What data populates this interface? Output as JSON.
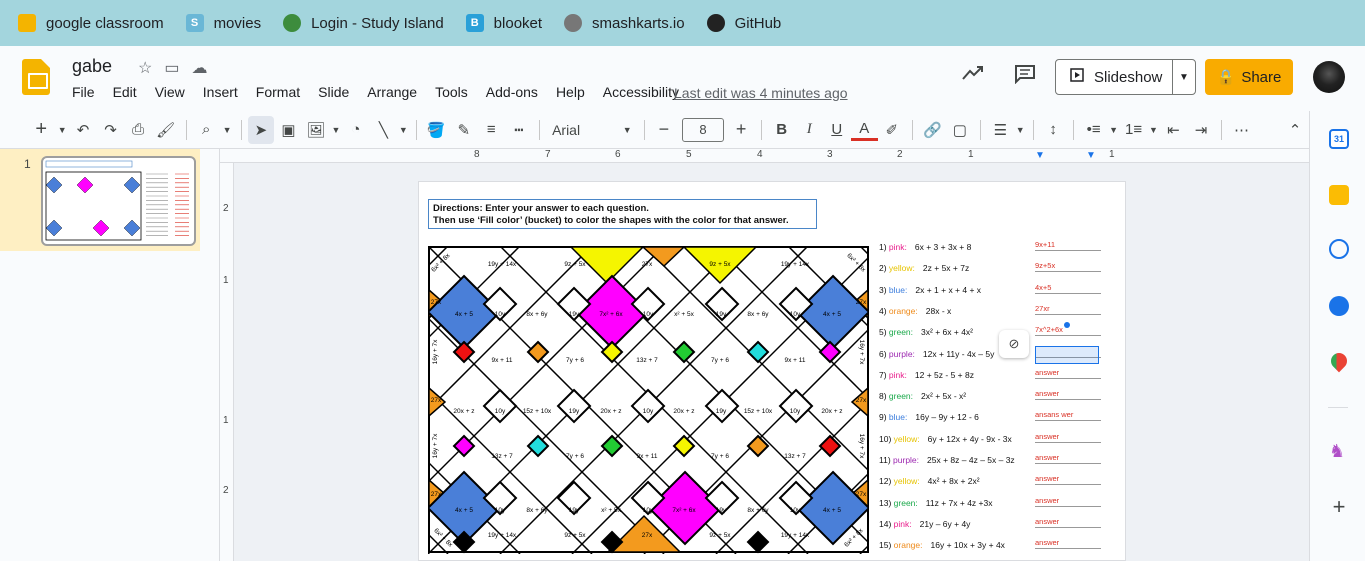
{
  "bookmarks": [
    {
      "label": "google classroom",
      "icon": "classroom-icon",
      "color": "#f4b400",
      "glyph": ""
    },
    {
      "label": "movies",
      "icon": "movies-s-icon",
      "color": "#6ab7d6",
      "glyph": "S"
    },
    {
      "label": "Login - Study Island",
      "icon": "study-island-icon",
      "color": "#3d8c3d",
      "glyph": ""
    },
    {
      "label": "blooket",
      "icon": "blooket-icon",
      "color": "#2aa0d8",
      "glyph": "B"
    },
    {
      "label": "smashkarts.io",
      "icon": "smashkarts-icon",
      "color": "#777777",
      "glyph": ""
    },
    {
      "label": "GitHub",
      "icon": "github-icon",
      "color": "#222222",
      "glyph": ""
    }
  ],
  "doc": {
    "title": "gabe",
    "last_edit": "Last edit was 4 minutes ago"
  },
  "menu": [
    "File",
    "Edit",
    "View",
    "Insert",
    "Format",
    "Slide",
    "Arrange",
    "Tools",
    "Add-ons",
    "Help",
    "Accessibility"
  ],
  "header_buttons": {
    "slideshow": "Slideshow",
    "share": "Share"
  },
  "toolbar": {
    "font": "Arial",
    "font_size": "8"
  },
  "filmstrip": {
    "slide_number": "1"
  },
  "ruler": {
    "top_marks": [
      "8",
      "7",
      "6",
      "5",
      "4",
      "3",
      "2",
      "1",
      "1"
    ],
    "left_marks": [
      "2",
      "1",
      "1",
      "2"
    ]
  },
  "slide": {
    "directions_line1": "Directions: Enter your answer to each question.",
    "directions_line2": "Then use ‘Fill color’ (bucket) to color the shapes with  the color for that answer.",
    "questions": [
      {
        "num": "1)",
        "color_word": "pink:",
        "color": "#e91e8c",
        "expr": "6x + 3 + 3x + 8",
        "answer": "9x+11"
      },
      {
        "num": "2)",
        "color_word": "yellow:",
        "color": "#e6c300",
        "expr": "2z + 5x + 7z",
        "answer": "9z+5x"
      },
      {
        "num": "3)",
        "color_word": "blue:",
        "color": "#3b7ddd",
        "expr": "2x + 1 + x + 4 + x",
        "answer": "4x+5"
      },
      {
        "num": "4)",
        "color_word": "orange:",
        "color": "#ee8a1a",
        "expr": "28x - x",
        "answer": "27xr"
      },
      {
        "num": "5)",
        "color_word": "green:",
        "color": "#1aa84a",
        "expr": "3x² + 6x + 4x²",
        "answer": "7x^2+6x"
      },
      {
        "num": "6)",
        "color_word": "purple:",
        "color": "#9c27b0",
        "expr": "12x + 11y - 4x – 5y",
        "answer": ""
      },
      {
        "num": "7)",
        "color_word": "pink:",
        "color": "#e91e8c",
        "expr": "12 + 5z - 5 + 8z",
        "answer": "answer"
      },
      {
        "num": "8)",
        "color_word": "green:",
        "color": "#1aa84a",
        "expr": "2x² + 5x - x²",
        "answer": "answer"
      },
      {
        "num": "9)",
        "color_word": "blue:",
        "color": "#3b7ddd",
        "expr": "16y – 9y + 12 - 6",
        "answer": "ansans wer"
      },
      {
        "num": "10)",
        "color_word": "yellow:",
        "color": "#e6c300",
        "expr": "6y + 12x + 4y - 9x - 3x",
        "answer": "answer"
      },
      {
        "num": "11)",
        "color_word": "purple:",
        "color": "#9c27b0",
        "expr": "25x + 8z – 4z – 5x – 3z",
        "answer": "answer"
      },
      {
        "num": "12)",
        "color_word": "yellow:",
        "color": "#e6c300",
        "expr": "4x² + 8x + 2x²",
        "answer": "answer"
      },
      {
        "num": "13)",
        "color_word": "green:",
        "color": "#1aa84a",
        "expr": "11z + 7x + 4z +3x",
        "answer": "answer"
      },
      {
        "num": "14)",
        "color_word": "pink:",
        "color": "#e91e8c",
        "expr": "21y – 6y + 4y",
        "answer": "answer"
      },
      {
        "num": "15)",
        "color_word": "orange:",
        "color": "#ee8a1a",
        "expr": "16y + 10x + 3y + 4x",
        "answer": "answer"
      }
    ],
    "grid_labels": {
      "top_row": [
        "19y + 14x",
        "9z + 5x",
        "27x",
        "9z + 5x",
        "19y + 14x"
      ],
      "row2": [
        "4x + 5",
        "10y",
        "8x + 6y",
        "19y",
        "7x² + 6x",
        "10y",
        "x² + 5x",
        "19y",
        "8x + 6y",
        "10y",
        "4x + 5"
      ],
      "row3": [
        "9x + 11",
        "7y + 6",
        "13z + 7",
        "7y + 6",
        "9x + 11"
      ],
      "row4": [
        "20x + z",
        "10y",
        "15z + 10x",
        "19y",
        "20x + z",
        "10y",
        "20x + z",
        "19y",
        "15z + 10x",
        "10y",
        "20x + z"
      ],
      "row5": [
        "13z + 7",
        "7y + 6",
        "9x + 11",
        "7y + 6",
        "13z + 7"
      ],
      "row6": [
        "4x + 5",
        "10y",
        "8x + 6y",
        "19y",
        "x² + 5x",
        "10y",
        "7x² + 6x",
        "19y",
        "8x + 6y",
        "10y",
        "4x + 5"
      ],
      "bottom_row": [
        "19y + 14x",
        "9z + 5x",
        "27x",
        "9z + 5x",
        "19y + 14x"
      ],
      "corner": "6x² + 8x",
      "side_orange": "27x",
      "side_vert": "16y + 7x"
    }
  },
  "colors": {
    "bookmark_bar": "#a3d5dd",
    "share": "#f9ab00",
    "blue": "#4a7fd8",
    "magenta": "#ff00ff",
    "yellow": "#f5f500",
    "orange": "#f39a1e",
    "green": "#22cc33",
    "cyan": "#22dddd",
    "red": "#ee1111"
  }
}
